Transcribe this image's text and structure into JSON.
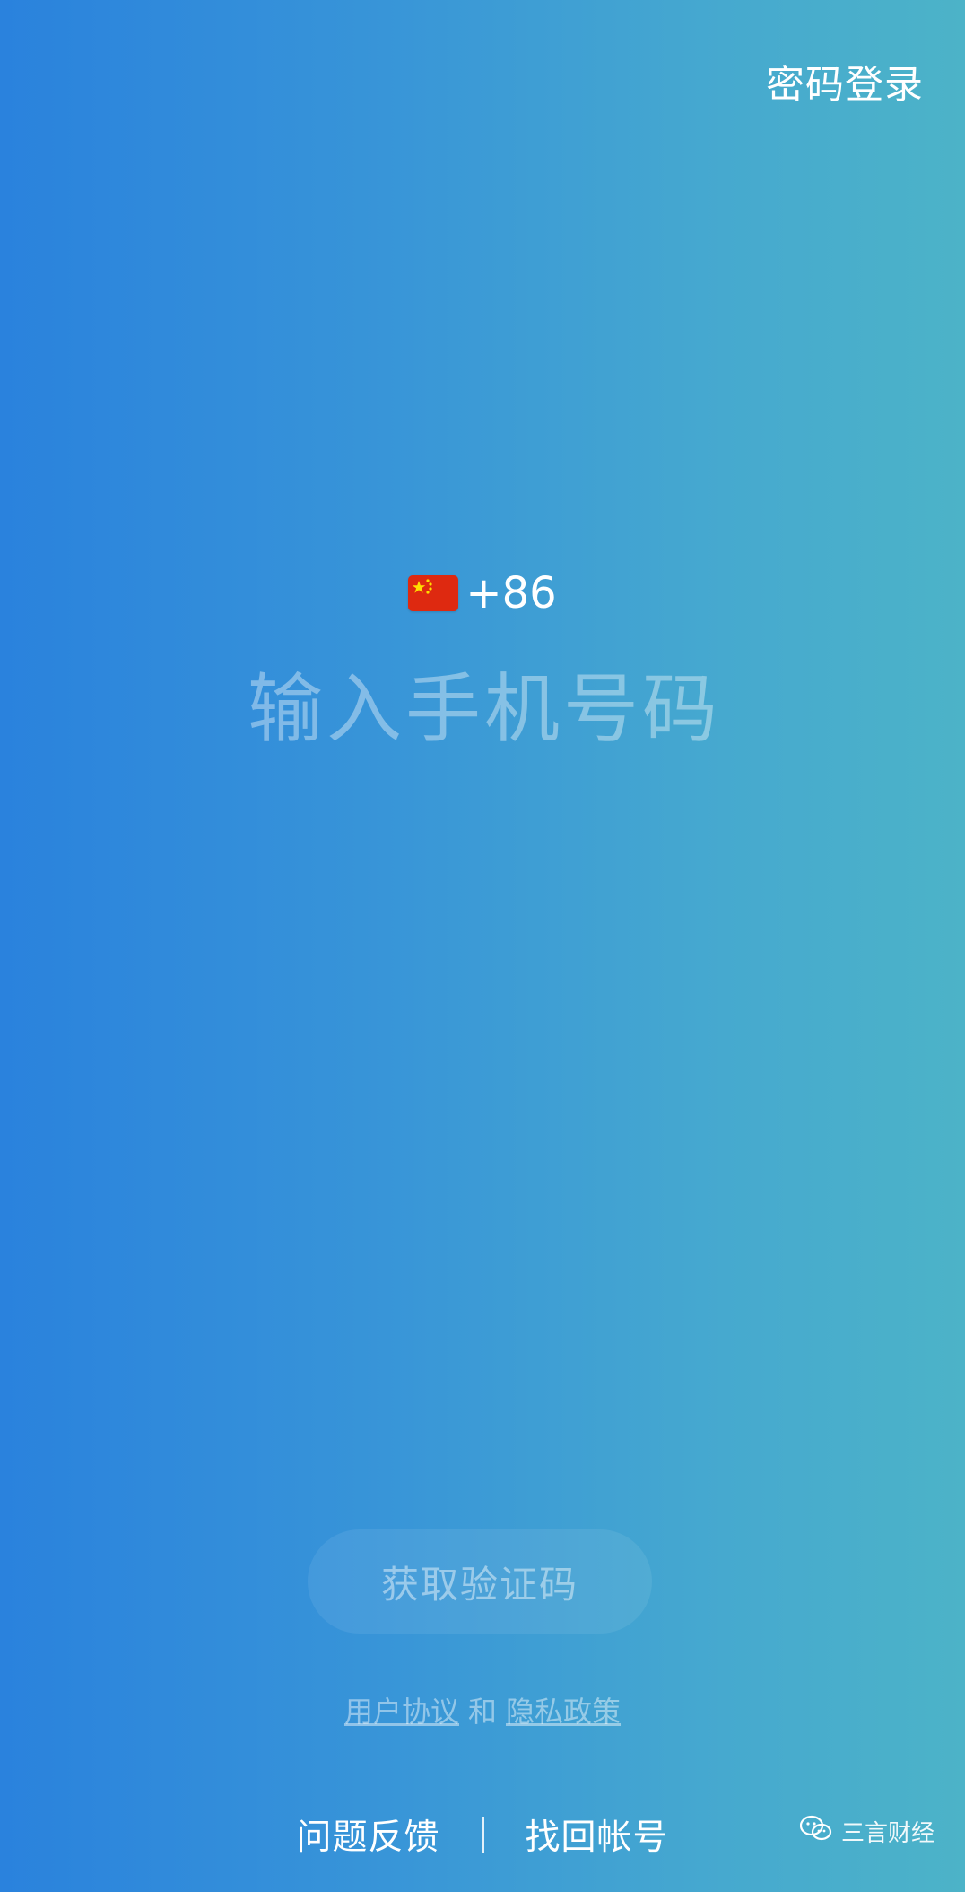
{
  "header": {
    "password_login_label": "密码登录"
  },
  "phone": {
    "country_flag_icon": "china-flag-icon",
    "country_code": "+86",
    "placeholder": "输入手机号码",
    "value": ""
  },
  "actions": {
    "get_code_label": "获取验证码"
  },
  "agreement": {
    "user_agreement": "用户协议",
    "conjunction": "和",
    "privacy_policy": "隐私政策"
  },
  "footer": {
    "feedback_label": "问题反馈",
    "separator": "|",
    "recover_account_label": "找回帐号"
  },
  "watermark": {
    "icon": "wechat-icon",
    "text": "三言财经"
  },
  "colors": {
    "gradient_left": "#2a82dd",
    "gradient_right": "#4cb3c8",
    "flag_red": "#de2910",
    "flag_yellow": "#ffde00"
  }
}
